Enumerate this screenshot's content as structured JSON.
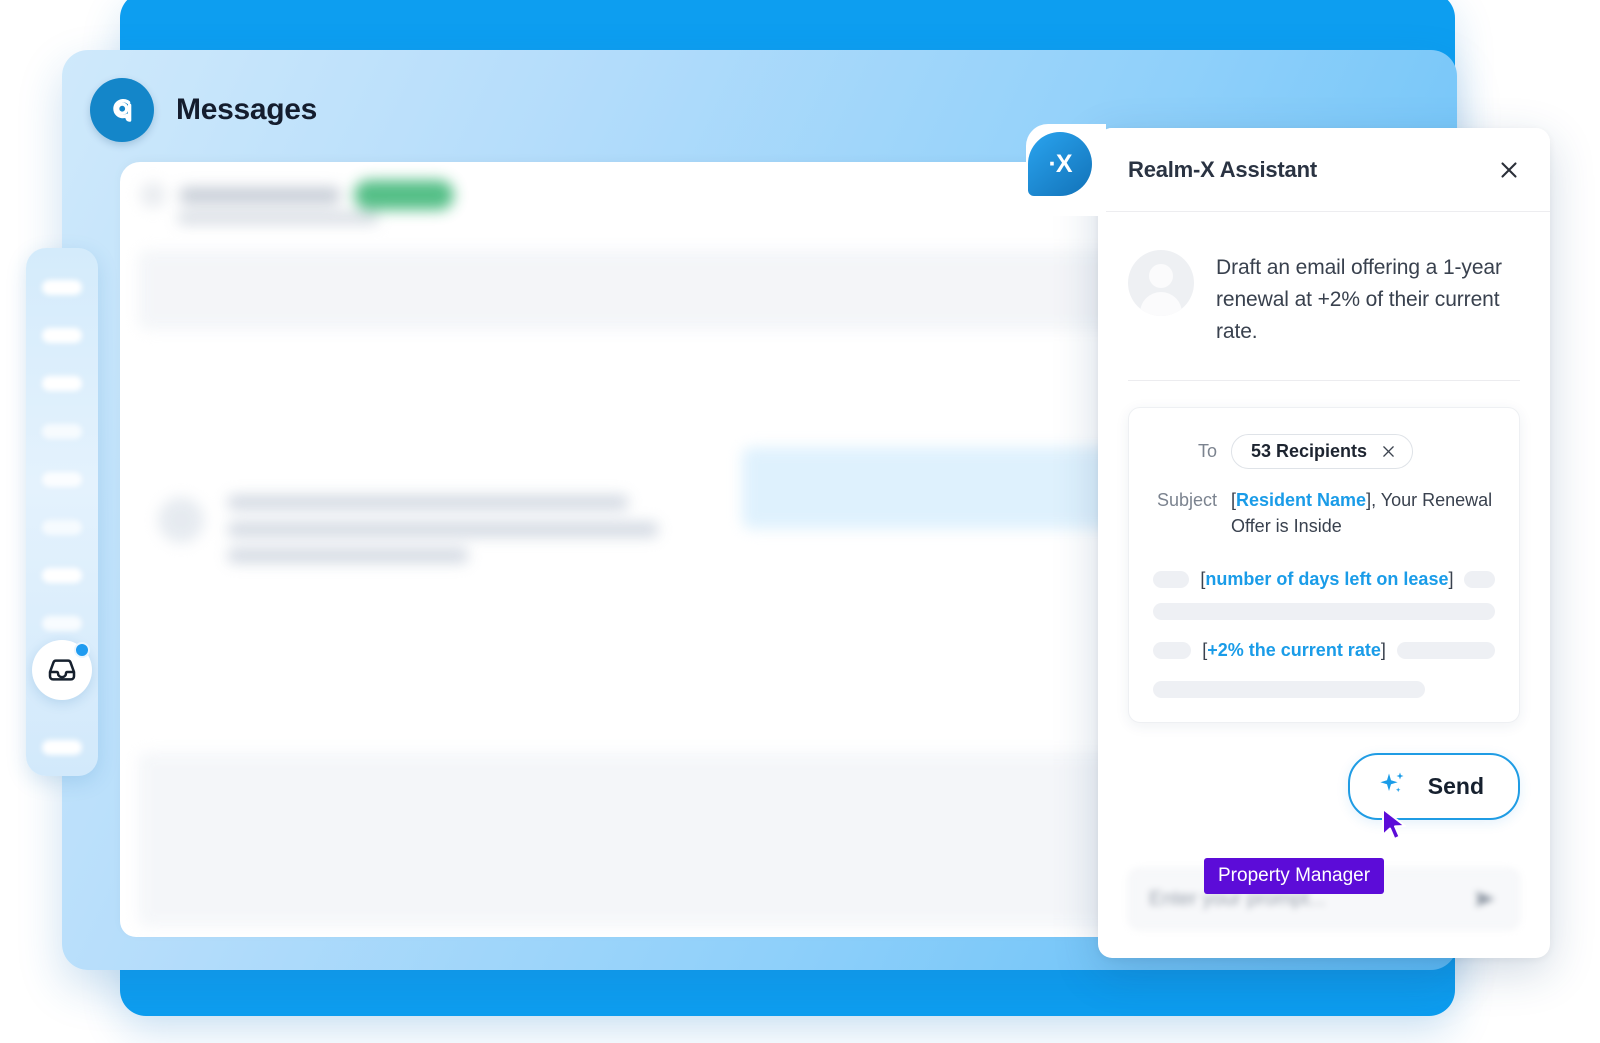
{
  "window": {
    "title": "Messages",
    "logo_icon": "brand-a-logo-icon"
  },
  "sidebar": {
    "active_item_icon": "inbox-icon",
    "notification_dot": true
  },
  "assistant": {
    "badge_text": "·X",
    "title": "Realm-X Assistant",
    "close_icon": "close-icon",
    "user_message": "Draft an email offering a 1-year renewal at +2% of their current rate.",
    "draft": {
      "to_label": "To",
      "recipients_chip": "53 Recipients",
      "chip_remove_icon": "close-icon",
      "subject_label": "Subject",
      "subject_token": "Resident Name",
      "subject_rest": ", Your Renewal Offer is Inside",
      "body_token_1": "number of days left on lease",
      "body_token_2": "+2% the current rate"
    },
    "send_button": {
      "label": "Send",
      "icon": "sparkle-icon"
    },
    "prompt": {
      "placeholder": "Enter your prompt...",
      "send_icon": "send-arrow-icon"
    }
  },
  "cursor": {
    "label": "Property Manager",
    "color": "#5c0cd8"
  },
  "colors": {
    "brand_blue": "#0d9ef0",
    "accent_blue": "#1a9ce8",
    "logo_blue": "#1486c9",
    "cursor_purple": "#5c0cd8",
    "badge_green": "#45b97c"
  }
}
